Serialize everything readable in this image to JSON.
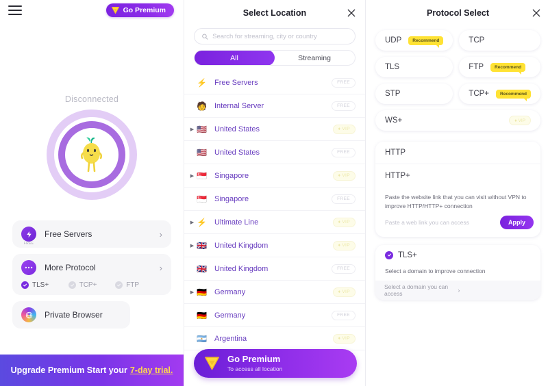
{
  "left": {
    "menu_icon": "hamburger-icon",
    "go_premium_label": "Go Premium",
    "status": "Disconnected",
    "cards": [
      {
        "icon": "bolt-icon",
        "sub": "FREE",
        "label": "Free Servers",
        "chevron": "›"
      },
      {
        "icon": "dots-icon",
        "sub": "",
        "label": "More Protocol",
        "chevron": "›"
      }
    ],
    "chips": [
      {
        "label": "TLS+",
        "checked": true
      },
      {
        "label": "TCP+",
        "checked": false
      },
      {
        "label": "FTP",
        "checked": false
      }
    ],
    "browser": {
      "icon": "globe-icon",
      "label": "Private Browser"
    },
    "banner": {
      "text": "Upgrade Premium Start your",
      "link": "7-day trial."
    }
  },
  "middle": {
    "title": "Select Location",
    "close_icon": "close-icon",
    "search": {
      "placeholder": "Search for streaming, city or country",
      "value": "",
      "icon": "search-icon"
    },
    "tabs": [
      {
        "label": "All",
        "active": true
      },
      {
        "label": "Streaming",
        "active": false
      }
    ],
    "servers": [
      {
        "name": "Free Servers",
        "flag": "⚡",
        "badge": "FREE",
        "vip": false,
        "expandable": false
      },
      {
        "name": "Internal Server",
        "flag": "🧑",
        "badge": "FREE",
        "vip": false,
        "expandable": false
      },
      {
        "name": "United States",
        "flag": "🇺🇸",
        "badge": "VIP",
        "vip": true,
        "expandable": true
      },
      {
        "name": "United States",
        "flag": "🇺🇸",
        "badge": "FREE",
        "vip": false,
        "expandable": false
      },
      {
        "name": "Singapore",
        "flag": "🇸🇬",
        "badge": "VIP",
        "vip": true,
        "expandable": true
      },
      {
        "name": "Singapore",
        "flag": "🇸🇬",
        "badge": "FREE",
        "vip": false,
        "expandable": false
      },
      {
        "name": "Ultimate Line",
        "flag": "⚡",
        "badge": "VIP",
        "vip": true,
        "expandable": true
      },
      {
        "name": "United Kingdom",
        "flag": "🇬🇧",
        "badge": "VIP",
        "vip": true,
        "expandable": true
      },
      {
        "name": "United Kingdom",
        "flag": "🇬🇧",
        "badge": "FREE",
        "vip": false,
        "expandable": false
      },
      {
        "name": "Germany",
        "flag": "🇩🇪",
        "badge": "VIP",
        "vip": true,
        "expandable": true
      },
      {
        "name": "Germany",
        "flag": "🇩🇪",
        "badge": "FREE",
        "vip": false,
        "expandable": false
      },
      {
        "name": "Argentina",
        "flag": "🇦🇷",
        "badge": "VIP",
        "vip": true,
        "expandable": false
      }
    ],
    "go_premium": {
      "title": "Go Premium",
      "subtitle": "To access all location"
    }
  },
  "right": {
    "title": "Protocol Select",
    "close_icon": "close-icon",
    "protocols": [
      {
        "label": "UDP",
        "tip": "Recommend",
        "vip": ""
      },
      {
        "label": "TCP",
        "tip": "",
        "vip": ""
      },
      {
        "label": "TLS",
        "tip": "",
        "vip": ""
      },
      {
        "label": "FTP",
        "tip": "Recommend",
        "vip": ""
      },
      {
        "label": "STP",
        "tip": "",
        "vip": ""
      },
      {
        "label": "TCP+",
        "tip": "Recommend",
        "vip": ""
      },
      {
        "label": "WS+",
        "tip": "",
        "vip": "VIP",
        "full": true
      }
    ],
    "http": {
      "row1": "HTTP",
      "row2": "HTTP+",
      "note": "Paste the website link that you can visit without VPN to improve HTTP/HTTP+ connection",
      "input_placeholder": "Paste a web link you can access",
      "input_value": "",
      "apply_label": "Apply"
    },
    "tls": {
      "title": "TLS+",
      "note": "Select a domain to improve connection",
      "select_placeholder": "Select a domain you can access",
      "chevron": "›"
    }
  },
  "colors": {
    "accent_purple": "#7a2ce0",
    "accent_gradient_end": "#a93cf2",
    "vip_yellow": "#ece7a8",
    "recommend_yellow": "#ffe234",
    "link_yellow": "#ffd84d",
    "server_name": "#6a3fc0"
  }
}
